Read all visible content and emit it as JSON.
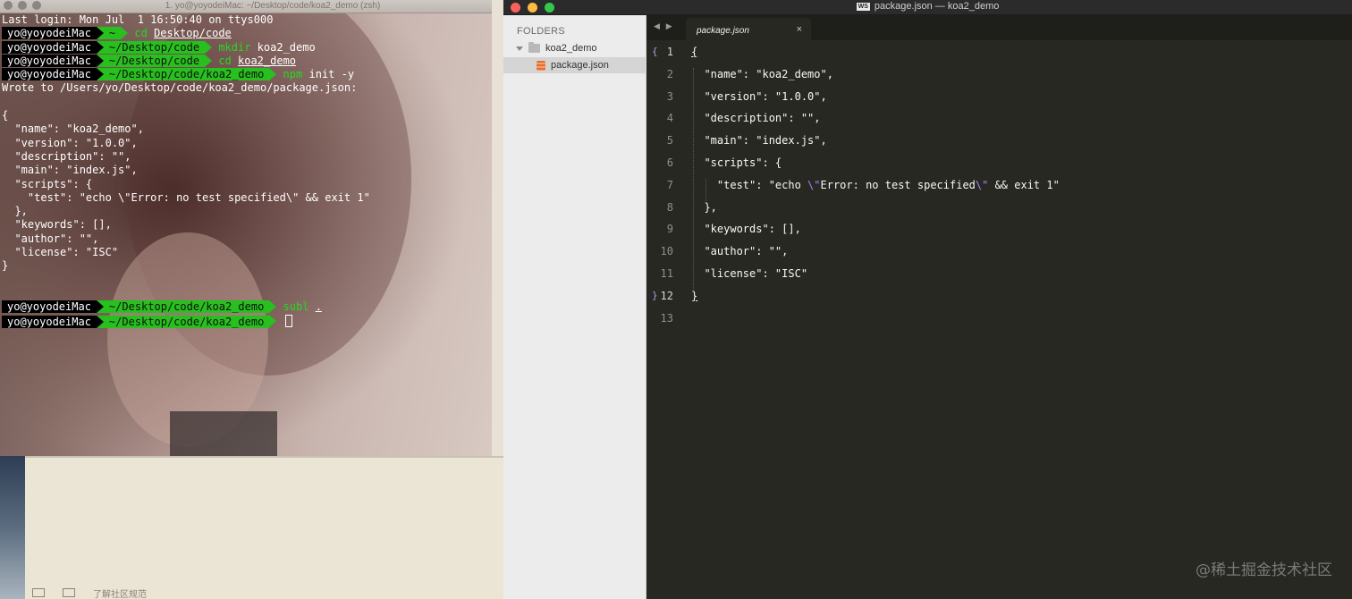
{
  "terminal": {
    "title": "1. yo@yoyodeiMac: ~/Desktop/code/koa2_demo (zsh)",
    "last_login": "Last login: Mon Jul  1 16:50:40 on ttys000",
    "user": "yo@yoyodeiMac",
    "prompts": [
      {
        "path": "~",
        "cmd": "cd",
        "arg": "Desktop/code"
      },
      {
        "path": "~/Desktop/code",
        "cmd": "mkdir",
        "arg": "koa2_demo"
      },
      {
        "path": "~/Desktop/code",
        "cmd": "cd",
        "arg": "koa2_demo"
      },
      {
        "path": "~/Desktop/code/koa2_demo",
        "cmd": "npm",
        "arg": "init -y"
      }
    ],
    "wrote_to": "Wrote to /Users/yo/Desktop/code/koa2_demo/package.json:",
    "output_lines": [
      "{",
      "  \"name\": \"koa2_demo\",",
      "  \"version\": \"1.0.0\",",
      "  \"description\": \"\",",
      "  \"main\": \"index.js\",",
      "  \"scripts\": {",
      "    \"test\": \"echo \\\"Error: no test specified\\\" && exit 1\"",
      "  },",
      "  \"keywords\": [],",
      "  \"author\": \"\",",
      "  \"license\": \"ISC\"",
      "}"
    ],
    "final_prompts": [
      {
        "path": "~/Desktop/code/koa2_demo",
        "cmd": "subl",
        "arg": "."
      },
      {
        "path": "~/Desktop/code/koa2_demo",
        "cmd": "",
        "arg": ""
      }
    ]
  },
  "background_footer": "了解社区规范",
  "sublime": {
    "title": "package.json — koa2_demo",
    "title_badge": "WS",
    "sidebar": {
      "folders_label": "FOLDERS",
      "folder_name": "koa2_demo",
      "file_name": "package.json"
    },
    "tab": {
      "label": "package.json",
      "close": "×",
      "nav": "◀ ▶"
    },
    "line_numbers": [
      "1",
      "2",
      "3",
      "4",
      "5",
      "6",
      "7",
      "8",
      "9",
      "10",
      "11",
      "12",
      "13"
    ],
    "fold_open": "{",
    "fold_close": "}",
    "code_lines": [
      "{",
      "  \"name\": \"koa2_demo\",",
      "  \"version\": \"1.0.0\",",
      "  \"description\": \"\",",
      "  \"main\": \"index.js\",",
      "  \"scripts\": {",
      "    \"test\": \"echo ",
      "  },",
      "  \"keywords\": [],",
      "  \"author\": \"\",",
      "  \"license\": \"ISC\"",
      "}",
      ""
    ],
    "test_line_parts": {
      "pre": "    \"test\": \"echo ",
      "esc1": "\\\"",
      "mid": "Error: no test specified",
      "esc2": "\\\"",
      "post": " && exit 1\""
    }
  },
  "watermark": "@稀土掘金技术社区"
}
